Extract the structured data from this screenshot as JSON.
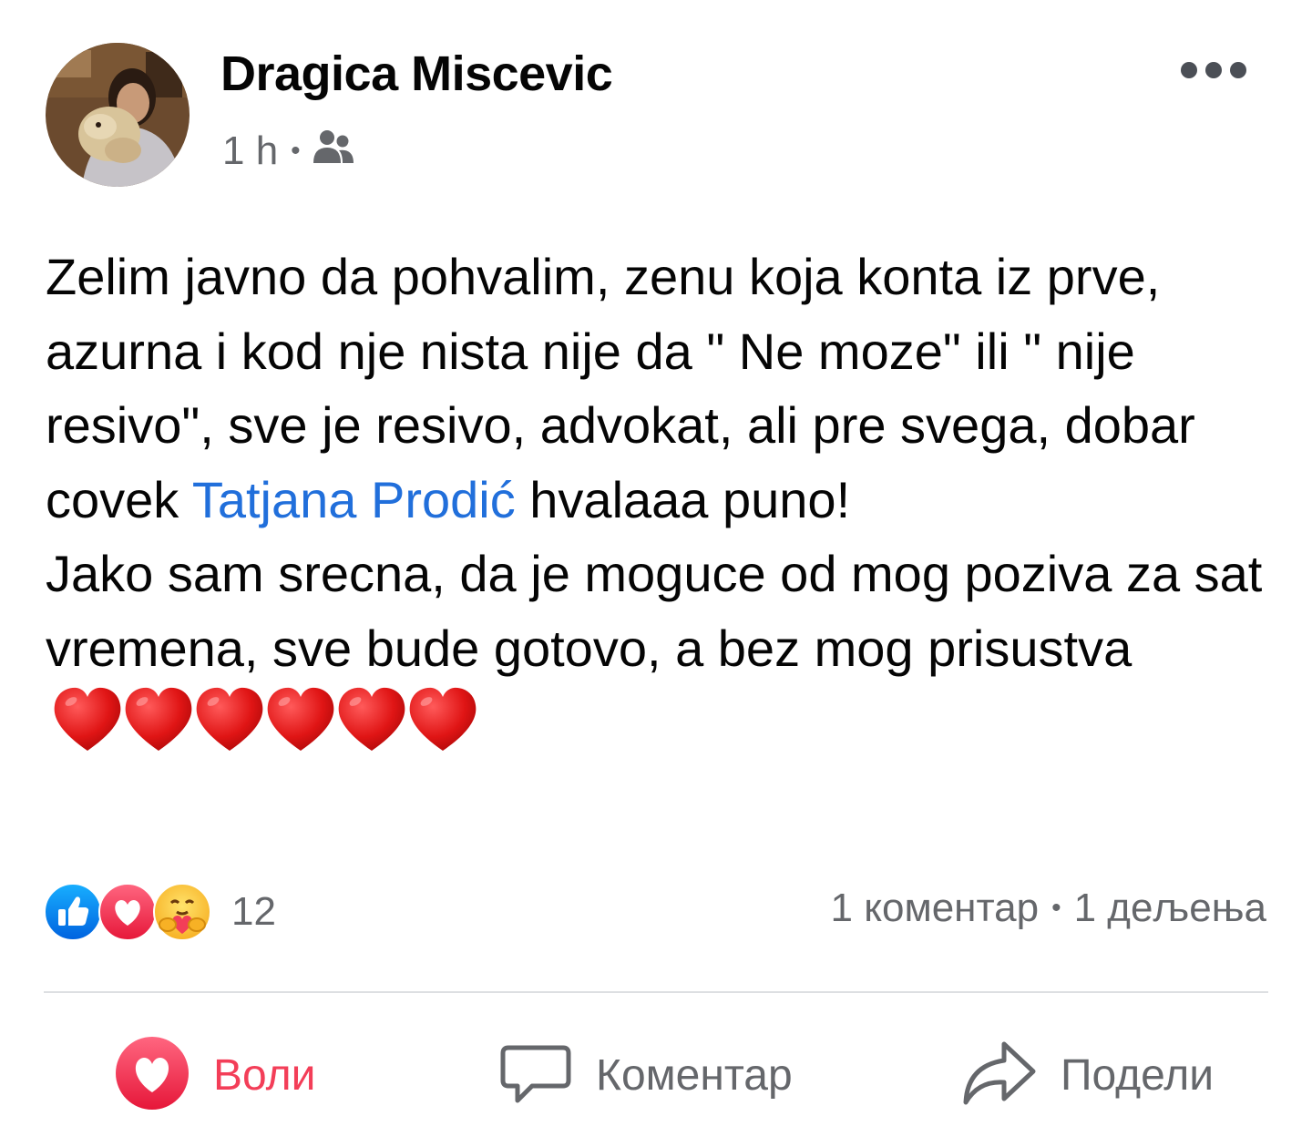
{
  "post": {
    "author": "Dragica Miscevic",
    "time": "1 h",
    "separator": "•",
    "audience_icon": "friends-icon",
    "more_icon": "more-options-icon",
    "body": {
      "para1_before": "Zelim javno da pohvalim, zenu koja konta iz prve, azurna i kod nje nista nije da \" Ne moze\" ili \" nije resivo\", sve je resivo, advokat, ali pre svega, dobar covek ",
      "mention": "Tatjana Prodić",
      "para1_after": " hvalaaa puno!",
      "para2": "Jako sam srecna, da je moguce od mog poziva za sat vremena, sve bude gotovo, a bez mog prisustva",
      "emoji": "red-heart-icon",
      "emoji_count": 6
    },
    "reactions": {
      "icons": [
        "like-icon",
        "love-icon",
        "care-icon"
      ],
      "count": "12"
    },
    "stats": {
      "comments": "1 коментар",
      "separator": "•",
      "shares": "1 дељења"
    },
    "actions": {
      "like": "Воли",
      "comment": "Коментар",
      "share": "Подели"
    }
  },
  "colors": {
    "mention": "#216fdb",
    "love_active": "#f33e58",
    "secondary_text": "#65676b",
    "like_blue": "#1877f2"
  }
}
